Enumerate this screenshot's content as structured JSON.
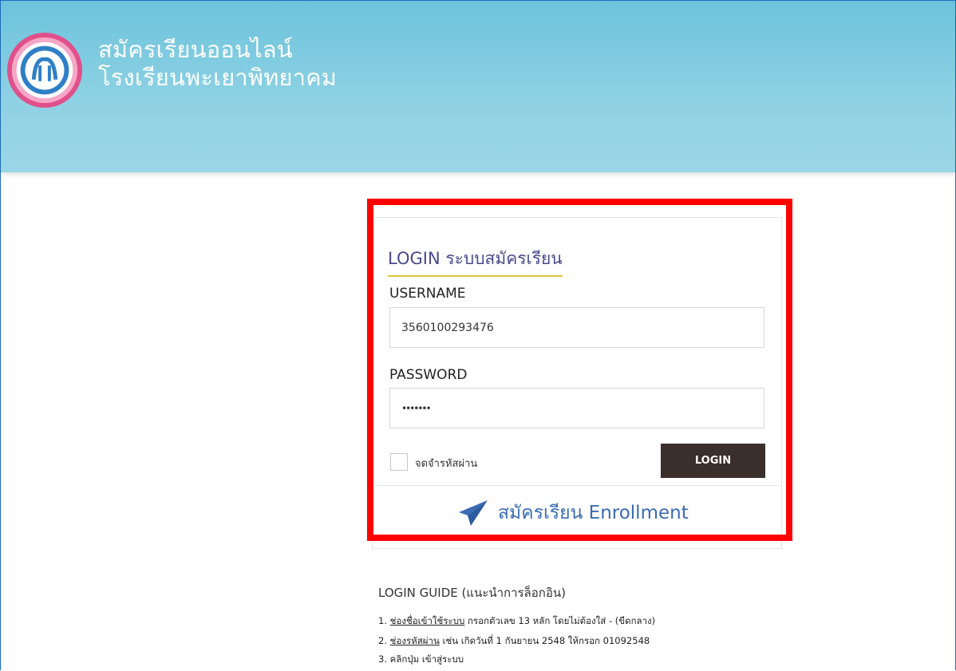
{
  "header": {
    "title_line1": "สมัครเรียนออนไลน์",
    "title_line2": "โรงเรียนพะเยาพิทยาคม"
  },
  "login": {
    "heading": "LOGIN ระบบสมัครเรียน",
    "username_label": "USERNAME",
    "username_value": "3560100293476",
    "password_label": "PASSWORD",
    "password_value": "•••••••",
    "remember_label": "จดจำรหัสผ่าน",
    "login_button": "LOGIN",
    "enroll_label": "สมัครเรียน Enrollment"
  },
  "guide": {
    "title": "LOGIN GUIDE (แนะนำการล็อกอิน)",
    "items": [
      {
        "num": "1.",
        "link": "ช่องชื่อเข้าใช้ระบบ",
        "text": "กรอกตัวเลข 13 หลัก โดยไม่ต้องใส่ - (ขีดกลาง)"
      },
      {
        "num": "2.",
        "link": "ช่องรหัสผ่าน",
        "text": "เช่น เกิดวันที่ 1 กันยายน 2548 ให้กรอก 01092548"
      },
      {
        "num": "3.",
        "link": "",
        "text": "คลิกปุ่ม เข้าสู่ระบบ"
      }
    ]
  },
  "colors": {
    "header_bg": "#8fd2e4",
    "highlight_border": "#ff0000",
    "login_button_bg": "#3b2f2c",
    "enroll_text": "#3a6cb3"
  },
  "icons": {
    "logo": "school-seal-icon",
    "enroll": "paper-plane-icon"
  }
}
